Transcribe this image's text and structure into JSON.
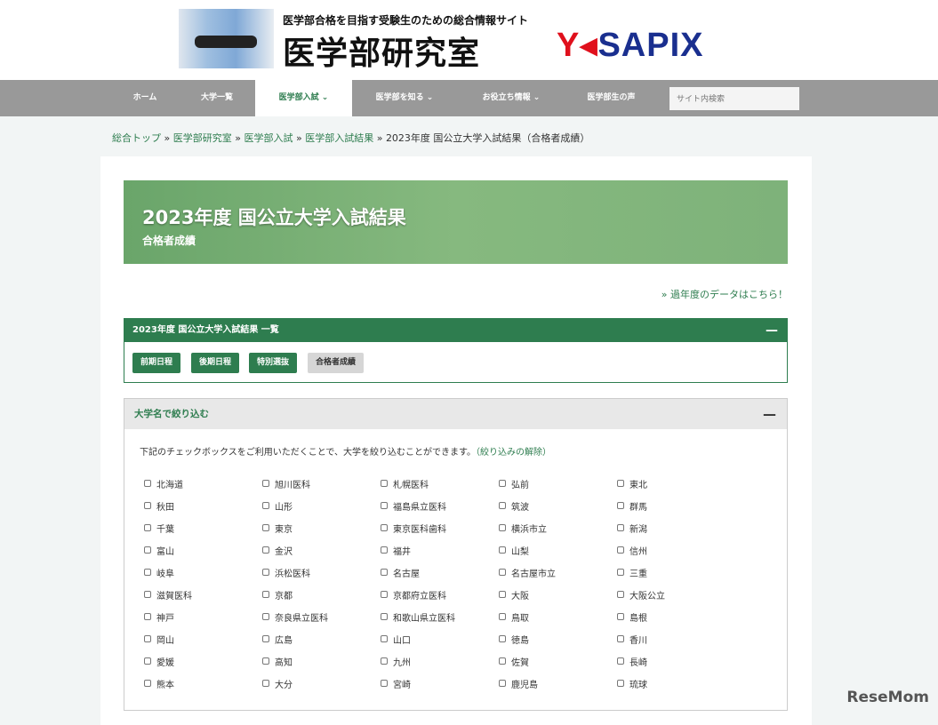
{
  "header": {
    "tagline": "医学部合格を目指す受験生のための総合情報サイト",
    "brand": "医学部研究室",
    "partner": {
      "prefix": "Y",
      "name": "SAPIX"
    }
  },
  "nav": {
    "items": [
      "ホーム",
      "大学一覧",
      "医学部入試 ⌄",
      "医学部を知る ⌄",
      "お役立ち情報 ⌄",
      "医学部生の声"
    ],
    "search_placeholder": "サイト内検索"
  },
  "breadcrumb": [
    "総合トップ",
    "医学部研究室",
    "医学部入試",
    "医学部入試結果"
  ],
  "breadcrumb_current": "2023年度 国公立大学入試結果（合格者成績）",
  "breadcrumb_sep": " » ",
  "hero": {
    "title": "2023年度 国公立大学入試結果",
    "subtitle": "合格者成績"
  },
  "past_link": "» 過年度のデータはこちら！",
  "results": {
    "title": "2023年度 国公立大学入試結果 一覧",
    "toggle": "—",
    "buttons": [
      "前期日程",
      "後期日程",
      "特別選抜",
      "合格者成績"
    ]
  },
  "filter": {
    "title": "大学名で絞り込む",
    "toggle": "—",
    "desc": "下記のチェックボックスをご利用いただくことで、大学を絞り込むことができます。",
    "clear": "（絞り込みの解除）",
    "universities": [
      "北海道",
      "旭川医科",
      "札幌医科",
      "弘前",
      "東北",
      "秋田",
      "山形",
      "福島県立医科",
      "筑波",
      "群馬",
      "千葉",
      "東京",
      "東京医科歯科",
      "横浜市立",
      "新潟",
      "富山",
      "金沢",
      "福井",
      "山梨",
      "信州",
      "岐阜",
      "浜松医科",
      "名古屋",
      "名古屋市立",
      "三重",
      "滋賀医科",
      "京都",
      "京都府立医科",
      "大阪",
      "大阪公立",
      "神戸",
      "奈良県立医科",
      "和歌山県立医科",
      "鳥取",
      "島根",
      "岡山",
      "広島",
      "山口",
      "徳島",
      "香川",
      "愛媛",
      "高知",
      "九州",
      "佐賀",
      "長崎",
      "熊本",
      "大分",
      "宮崎",
      "鹿児島",
      "琉球"
    ]
  },
  "watermark": "ReseMom"
}
